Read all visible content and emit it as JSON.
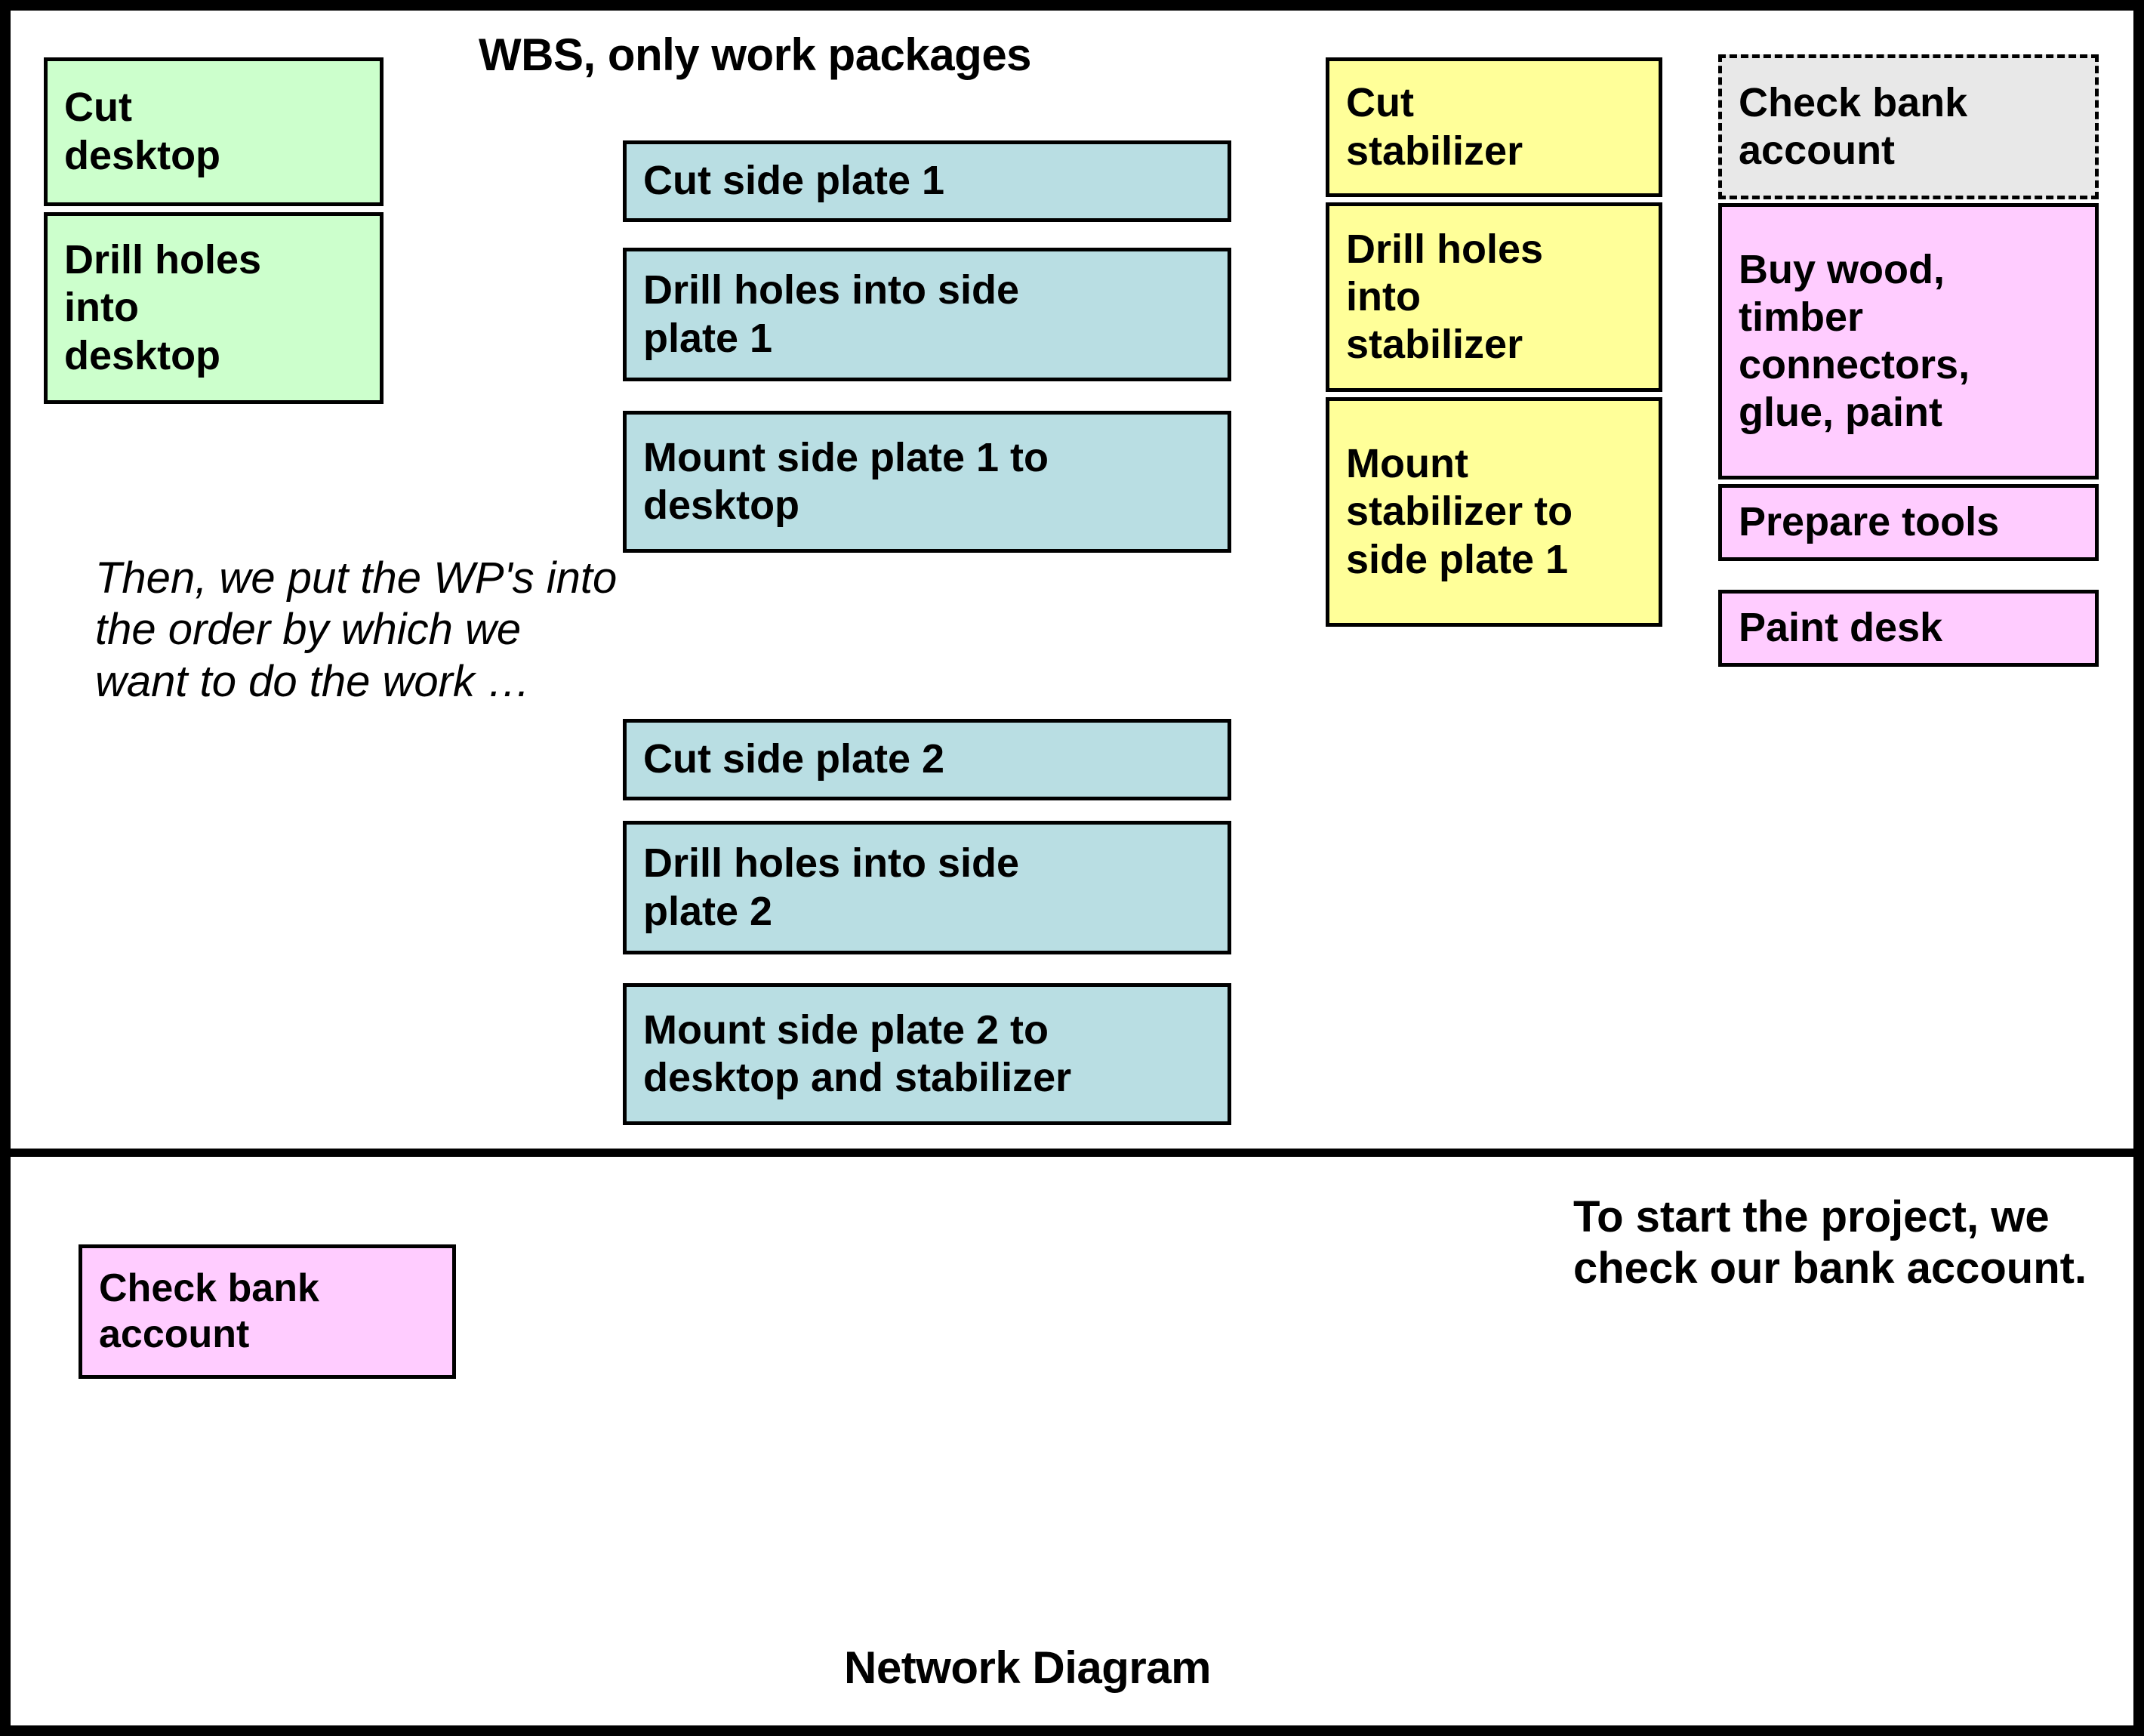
{
  "colors": {
    "green": "#ccffcc",
    "blue": "#b9dee3",
    "yellow": "#ffff99",
    "pink": "#ffccff",
    "grey": "#e8e8e8",
    "border": "#000000",
    "background": "#ffffff"
  },
  "wbs_pane": {
    "title": "WBS, only work packages",
    "note": "Then, we put the WP's into the order by which we want to do the work …",
    "desktop_group": [
      {
        "label": "Cut\ndesktop",
        "color": "green"
      },
      {
        "label": "Drill holes\ninto\ndesktop",
        "color": "green"
      }
    ],
    "side_plate_1_group": [
      {
        "label": "Cut side plate 1",
        "color": "blue"
      },
      {
        "label": "Drill holes into side\nplate 1",
        "color": "blue"
      },
      {
        "label": "Mount side plate 1 to\ndesktop",
        "color": "blue"
      }
    ],
    "side_plate_2_group": [
      {
        "label": "Cut side plate 2",
        "color": "blue"
      },
      {
        "label": "Drill holes into side\nplate 2",
        "color": "blue"
      },
      {
        "label": "Mount side plate 2 to\ndesktop and stabilizer",
        "color": "blue"
      }
    ],
    "stabilizer_group": [
      {
        "label": "Cut\nstabilizer",
        "color": "yellow"
      },
      {
        "label": "Drill holes\ninto\nstabilizer",
        "color": "yellow"
      },
      {
        "label": "Mount\nstabilizer to\nside plate 1",
        "color": "yellow"
      }
    ],
    "support_group": [
      {
        "label": "Check bank\naccount",
        "color": "grey",
        "style": "dashed"
      },
      {
        "label": "Buy wood,\ntimber\nconnectors,\nglue, paint",
        "color": "pink"
      },
      {
        "label": "Prepare tools",
        "color": "pink"
      },
      {
        "label": "Paint desk",
        "color": "pink"
      }
    ]
  },
  "network_pane": {
    "title": "Network Diagram",
    "note": "To start the project, we check our bank account.",
    "nodes": [
      {
        "label": "Check bank\naccount",
        "color": "pink"
      }
    ]
  }
}
